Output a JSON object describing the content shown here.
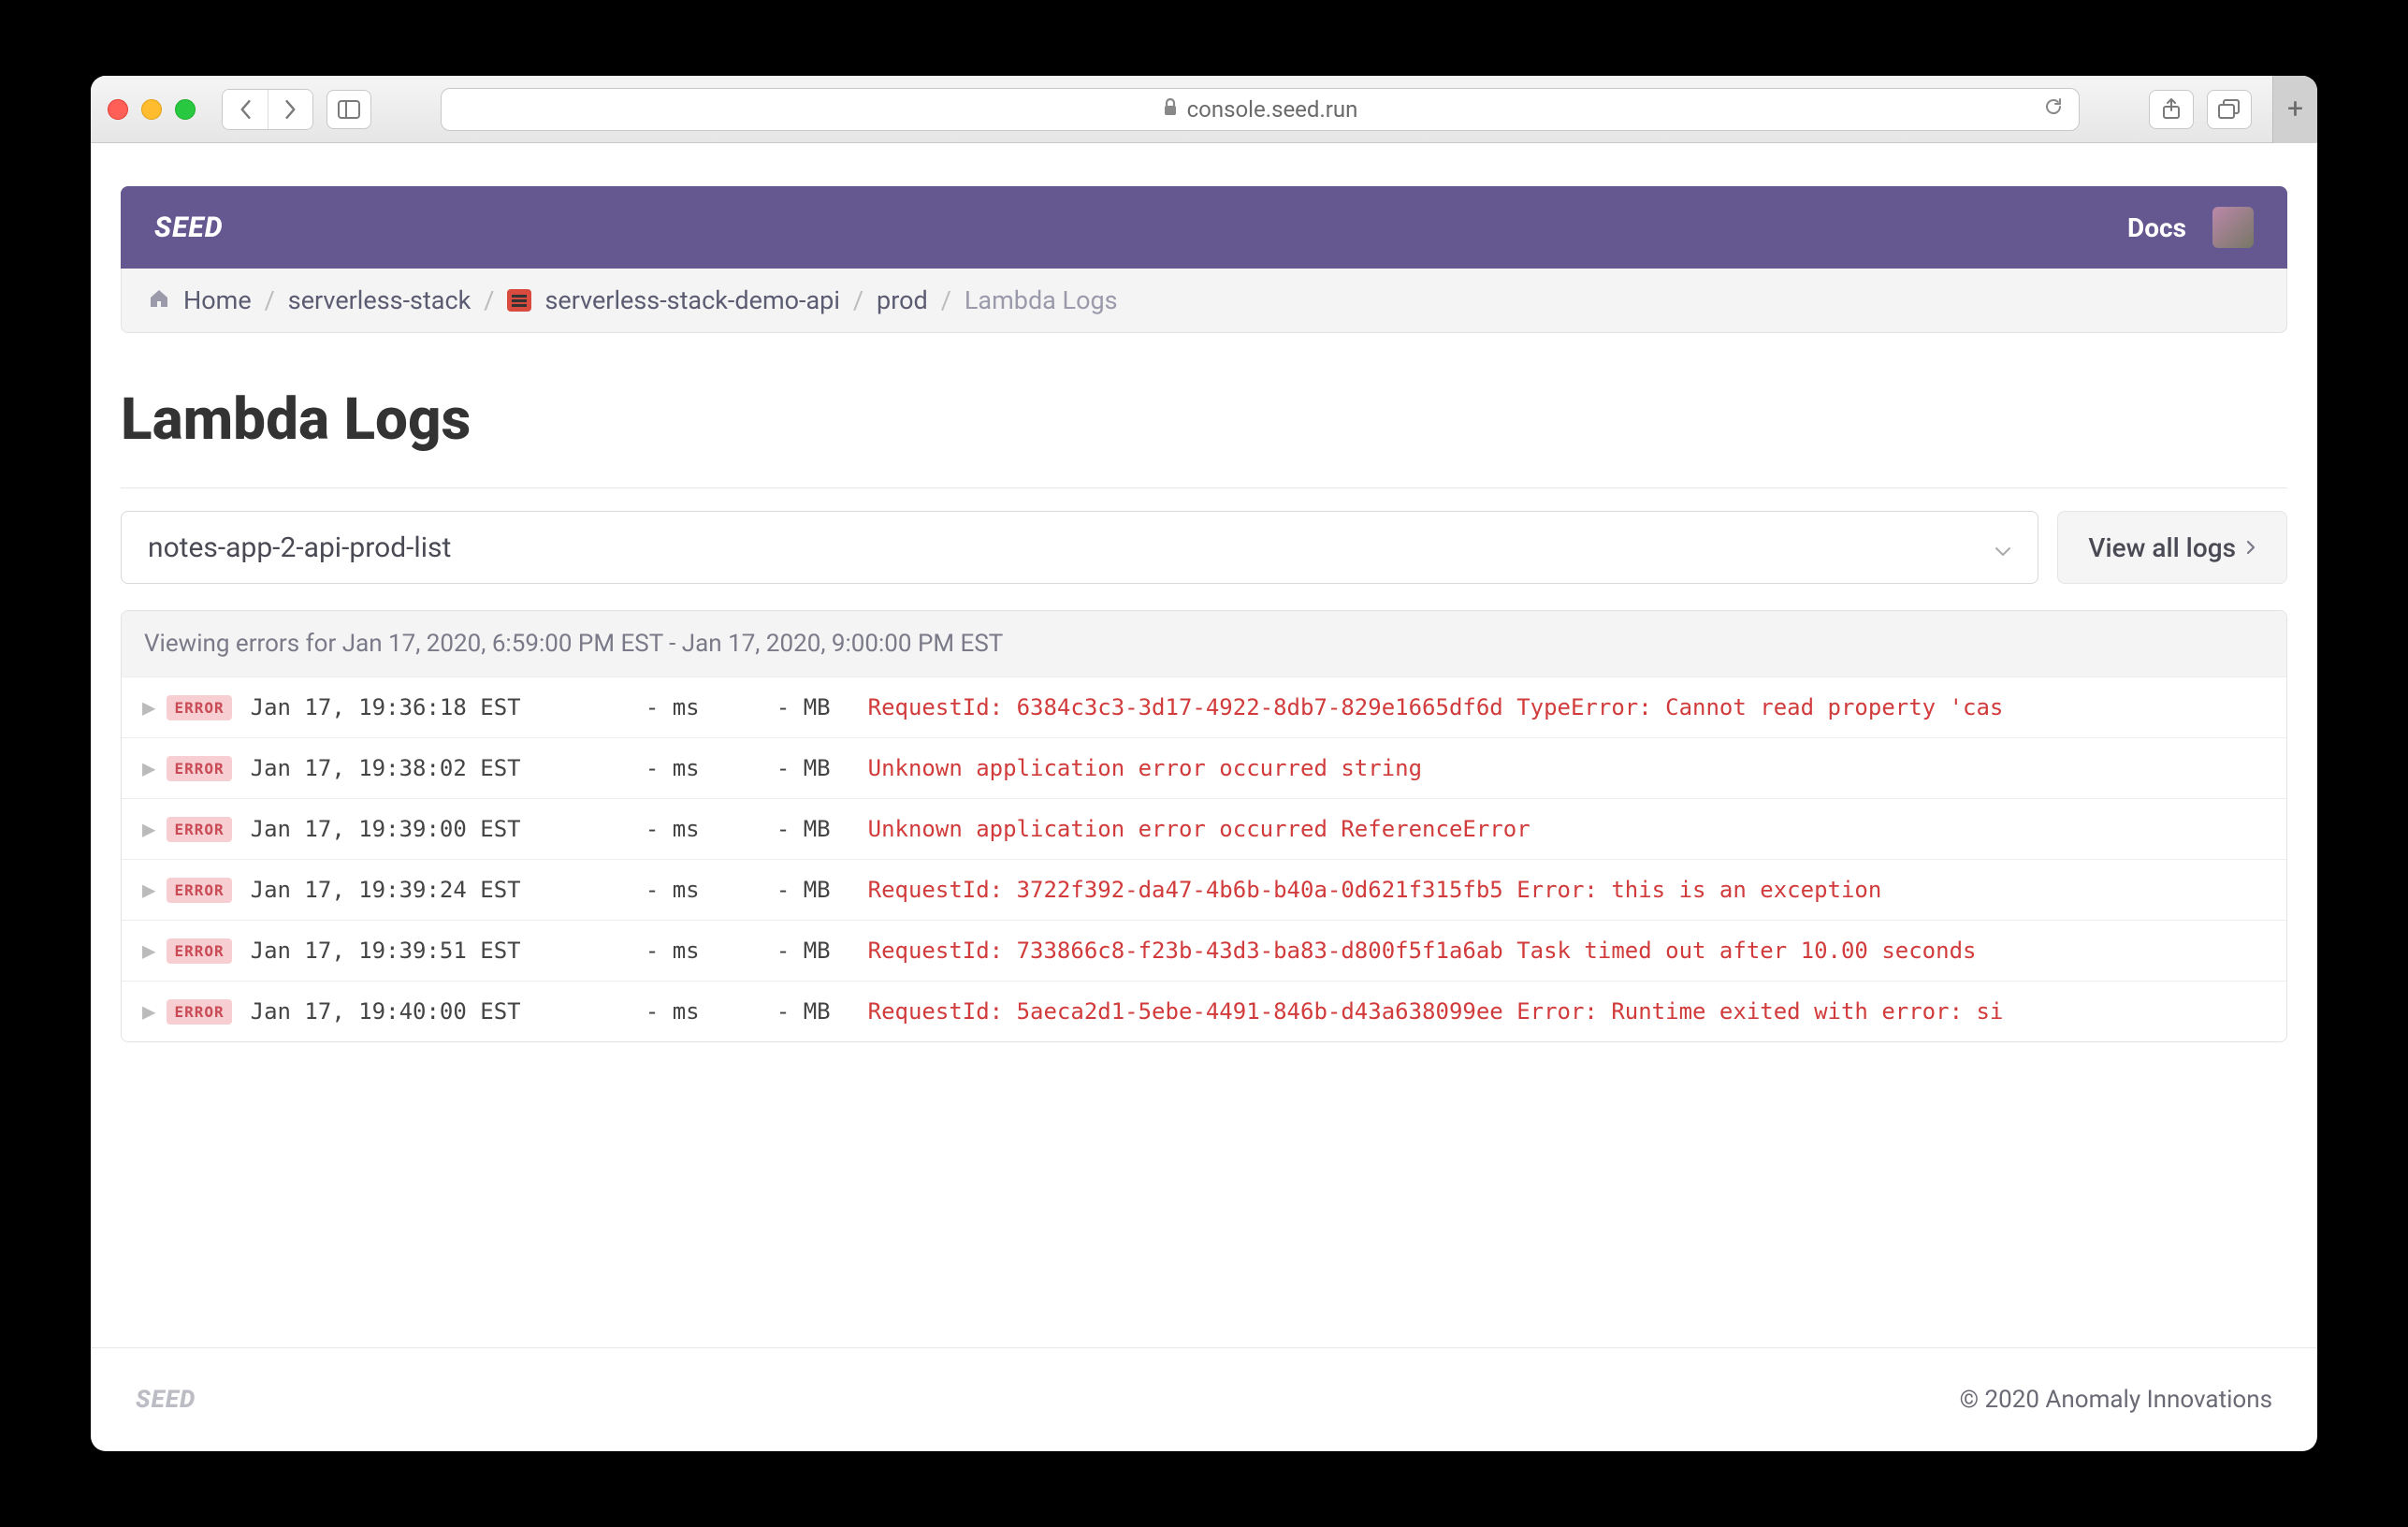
{
  "browser": {
    "url_text": "console.seed.run"
  },
  "header": {
    "brand": "SEED",
    "docs_label": "Docs"
  },
  "breadcrumb": {
    "home": "Home",
    "items": [
      "serverless-stack",
      "serverless-stack-demo-api",
      "prod"
    ],
    "current": "Lambda Logs"
  },
  "page": {
    "title": "Lambda Logs"
  },
  "controls": {
    "dropdown_value": "notes-app-2-api-prod-list",
    "view_all_label": "View all logs"
  },
  "logs": {
    "panel_header": "Viewing errors for Jan 17, 2020, 6:59:00 PM EST - Jan 17, 2020, 9:00:00 PM EST",
    "badge_label": "ERROR",
    "rows": [
      {
        "ts": "Jan 17, 19:36:18 EST",
        "dur": "- ms",
        "mem": "- MB",
        "msg": "RequestId: 6384c3c3-3d17-4922-8db7-829e1665df6d TypeError: Cannot read property 'cas"
      },
      {
        "ts": "Jan 17, 19:38:02 EST",
        "dur": "- ms",
        "mem": "- MB",
        "msg": "Unknown application error occurred string"
      },
      {
        "ts": "Jan 17, 19:39:00 EST",
        "dur": "- ms",
        "mem": "- MB",
        "msg": "Unknown application error occurred ReferenceError"
      },
      {
        "ts": "Jan 17, 19:39:24 EST",
        "dur": "- ms",
        "mem": "- MB",
        "msg": "RequestId: 3722f392-da47-4b6b-b40a-0d621f315fb5 Error: this is an exception"
      },
      {
        "ts": "Jan 17, 19:39:51 EST",
        "dur": "- ms",
        "mem": "- MB",
        "msg": "RequestId: 733866c8-f23b-43d3-ba83-d800f5f1a6ab Task timed out after 10.00 seconds"
      },
      {
        "ts": "Jan 17, 19:40:00 EST",
        "dur": "- ms",
        "mem": "- MB",
        "msg": "RequestId: 5aeca2d1-5ebe-4491-846b-d43a638099ee Error: Runtime exited with error: si"
      }
    ]
  },
  "footer": {
    "brand": "SEED",
    "copyright": "© 2020 Anomaly Innovations"
  }
}
